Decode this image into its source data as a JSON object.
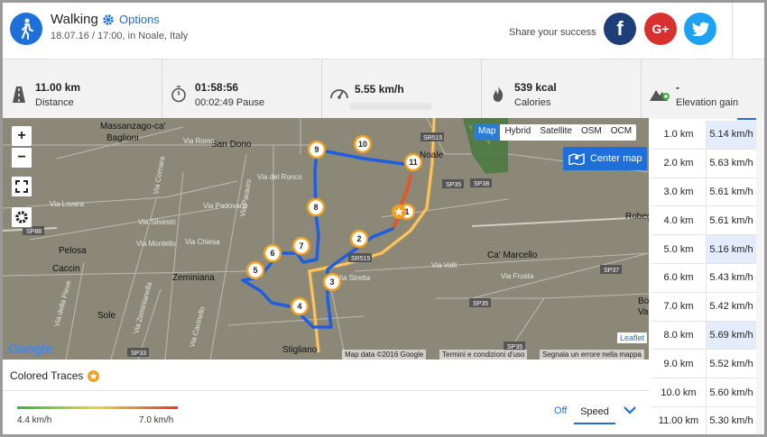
{
  "header": {
    "title": "Walking",
    "options_label": "Options",
    "subtitle": "18.07.16 / 17:00, in Noale, Italy",
    "share_text": "Share your success",
    "social": {
      "facebook": "f",
      "google": "G+",
      "twitter": "twitter-bird"
    }
  },
  "stats": [
    {
      "value": "11.00 km",
      "label": "Distance",
      "icon": "road-icon"
    },
    {
      "value": "01:58:56",
      "label": "00:02:49 Pause",
      "icon": "stopwatch-icon"
    },
    {
      "value": "5.55 km/h",
      "label": "",
      "icon": "speedometer-icon"
    },
    {
      "value": "539 kcal",
      "label": "Calories",
      "icon": "flame-icon"
    },
    {
      "value": "-",
      "label": "Elevation gain",
      "icon": "elevation-icon"
    }
  ],
  "map": {
    "zoom_in": "+",
    "zoom_out": "−",
    "types": [
      "Map",
      "Hybrid",
      "Satellite",
      "OSM",
      "OCM"
    ],
    "active_type": "Map",
    "center_label": "Center map",
    "attribution": "Map data ©2016 Google",
    "terms": "Termini e condizioni d'uso",
    "report": "Segnala un errore nella mappa",
    "leaflet": "Leaflet",
    "google_logo": "Google",
    "towns": [
      "Massanzago-ca'",
      "Baglioni",
      "San Dono",
      "Noale",
      "Pelosa",
      "Caccin",
      "Zeminiana",
      "Sole",
      "Stigliano",
      "Ca' Marcello",
      "Robeg",
      "Bo",
      "Va"
    ],
    "streets": [
      "Via Roma",
      "Via del Ronco",
      "Via Cornara",
      "Via Padovane",
      "Via Parauro",
      "Via Silvestri",
      "Via Montello",
      "Via Chiesa",
      "Via Lovara",
      "Via della Pieve",
      "Via Zeminianella",
      "Via Cavinello",
      "Via Stretta",
      "Via Valli",
      "Via Frusta"
    ],
    "shields": [
      "SR515",
      "SP35",
      "SP38",
      "SP88",
      "SR515",
      "SP37",
      "SP35",
      "SP33",
      "SP35"
    ],
    "markers": [
      "1",
      "2",
      "3",
      "4",
      "5",
      "6",
      "7",
      "8",
      "9",
      "10",
      "11"
    ]
  },
  "traces": {
    "label": "Colored Traces",
    "min": "4.4 km/h",
    "max": "7.0 km/h",
    "off_label": "Off",
    "mode": "Speed"
  },
  "splits": [
    {
      "km": "1.0 km",
      "speed": "5.14 km/h"
    },
    {
      "km": "2.0 km",
      "speed": "5.63 km/h"
    },
    {
      "km": "3.0 km",
      "speed": "5.61 km/h"
    },
    {
      "km": "4.0 km",
      "speed": "5.61 km/h"
    },
    {
      "km": "5.0 km",
      "speed": "5.16 km/h"
    },
    {
      "km": "6.0 km",
      "speed": "5.43 km/h"
    },
    {
      "km": "7.0 km",
      "speed": "5.42 km/h"
    },
    {
      "km": "8.0 km",
      "speed": "5.69 km/h"
    },
    {
      "km": "9.0 km",
      "speed": "5.52 km/h"
    },
    {
      "km": "10.0 km",
      "speed": "5.60 km/h"
    },
    {
      "km": "11.00 km",
      "speed": "5.30 km/h"
    }
  ]
}
